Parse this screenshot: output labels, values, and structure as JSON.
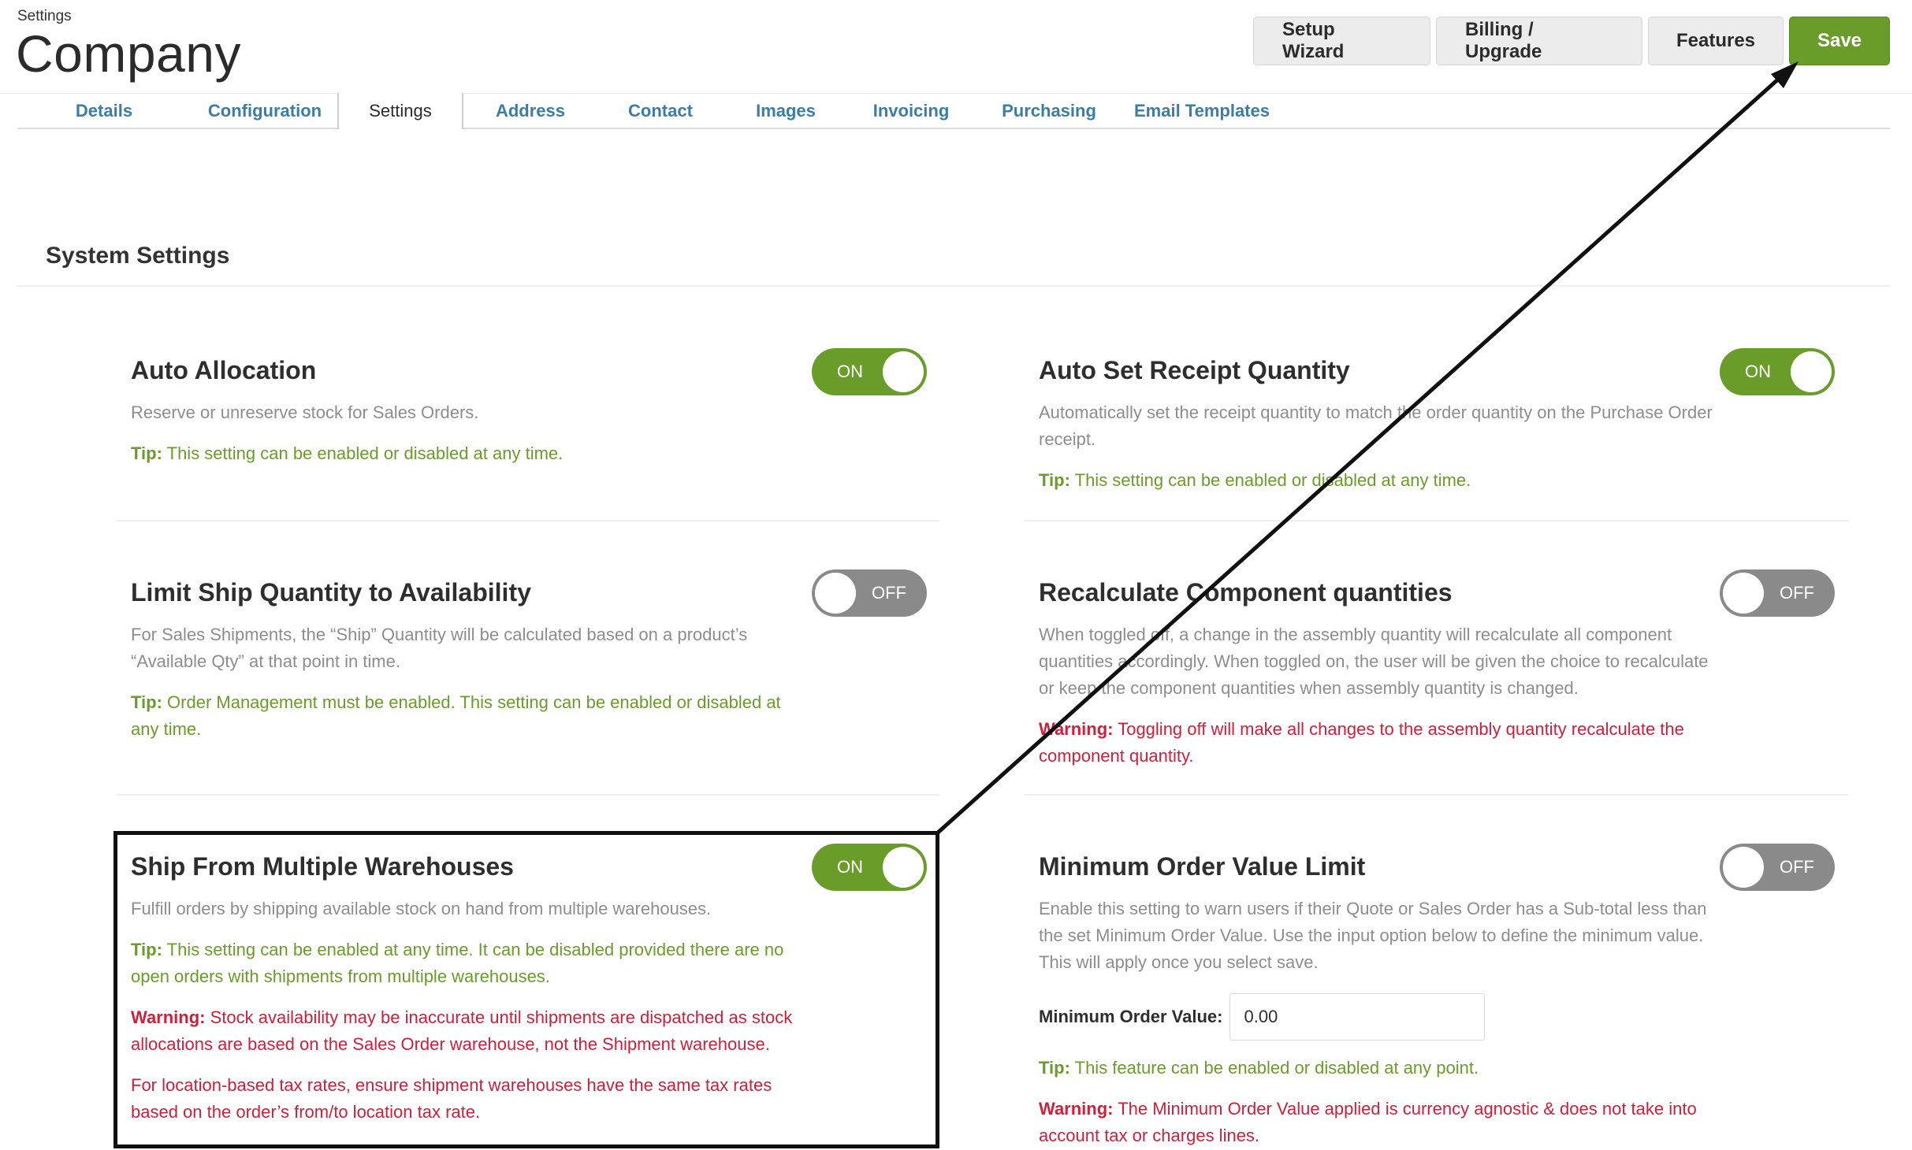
{
  "header": {
    "breadcrumb": "Settings",
    "title": "Company",
    "buttons": {
      "setup_wizard": "Setup Wizard",
      "billing_upgrade": "Billing / Upgrade",
      "features": "Features",
      "save": "Save"
    }
  },
  "tabs": [
    {
      "label": "Details"
    },
    {
      "label": "Configuration"
    },
    {
      "label": "Settings",
      "active": true
    },
    {
      "label": "Address"
    },
    {
      "label": "Contact"
    },
    {
      "label": "Images"
    },
    {
      "label": "Invoicing"
    },
    {
      "label": "Purchasing"
    },
    {
      "label": "Email Templates"
    }
  ],
  "section": {
    "title": "System Settings"
  },
  "settings": {
    "auto_allocation": {
      "title": "Auto Allocation",
      "toggle": "ON",
      "description": "Reserve or unreserve stock for Sales Orders.",
      "tip_label": "Tip:",
      "tip": " This setting can be enabled or disabled at any time."
    },
    "auto_set_receipt": {
      "title": "Auto Set Receipt Quantity",
      "toggle": "ON",
      "description": "Automatically set the receipt quantity to match the order quantity on the Purchase Order receipt.",
      "tip_label": "Tip:",
      "tip": " This setting can be enabled or disabled at any time."
    },
    "limit_ship_qty": {
      "title": "Limit Ship Quantity to Availability",
      "toggle": "OFF",
      "description": "For Sales Shipments, the “Ship” Quantity will be calculated based on a product’s “Available Qty” at that point in time.",
      "tip_label": "Tip:",
      "tip": " Order Management must be enabled. This setting can be enabled or disabled at any time."
    },
    "recalc_component": {
      "title": "Recalculate Component quantities",
      "toggle": "OFF",
      "description": "When toggled off, a change in the assembly quantity will recalculate all component quantities accordingly. When toggled on, the user will be given the choice to recalculate or keep the component quantities when assembly quantity is changed.",
      "warning_label": "Warning:",
      "warning": " Toggling off will make all changes to the assembly quantity recalculate the component quantity."
    },
    "ship_multi_wh": {
      "title": "Ship From Multiple Warehouses",
      "toggle": "ON",
      "description": "Fulfill orders by shipping available stock on hand from multiple warehouses.",
      "tip_label": "Tip:",
      "tip": " This setting can be enabled at any time. It can be disabled provided there are no open orders with shipments from multiple warehouses.",
      "warning_label": "Warning:",
      "warning": " Stock availability may be inaccurate until shipments are dispatched as stock allocations are based on the Sales Order warehouse, not the Shipment warehouse.",
      "warning2": "For location-based tax rates, ensure shipment warehouses have the same tax rates based on the order’s from/to location tax rate."
    },
    "min_order_value": {
      "title": "Minimum Order Value Limit",
      "toggle": "OFF",
      "description": "Enable this setting to warn users if their Quote or Sales Order has a Sub-total less than the set Minimum Order Value. Use the input option below to define the minimum value. This will apply once you select save.",
      "input_label": "Minimum Order Value:",
      "input_value": "0.00",
      "tip_label": "Tip:",
      "tip": " This feature can be enabled or disabled at any point.",
      "warning_label": "Warning:",
      "warning": " The Minimum Order Value applied is currency agnostic & does not take into account tax or charges lines."
    }
  },
  "colors": {
    "accent_green": "#6a9c2a",
    "link_blue": "#3a7ea6",
    "warning_red": "#cf1f3a",
    "toggle_off": "#8a8a8a"
  }
}
